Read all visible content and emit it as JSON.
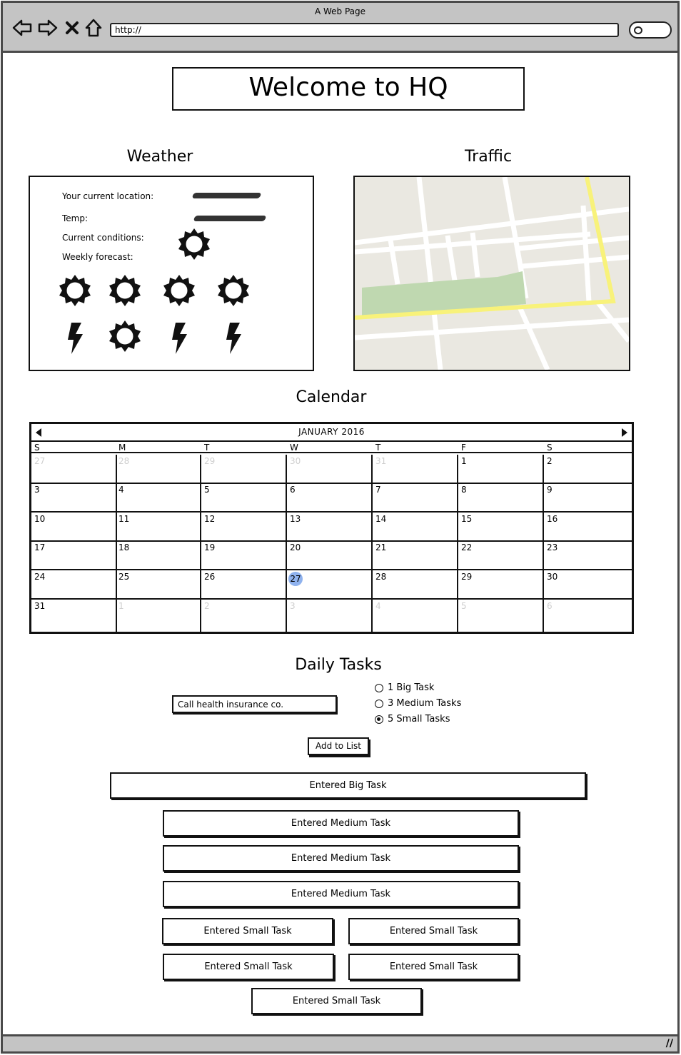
{
  "browser": {
    "window_title": "A Web Page",
    "url": "http://"
  },
  "page": {
    "title": "Welcome to HQ"
  },
  "weather": {
    "heading": "Weather",
    "location_label": "Your current location:",
    "temp_label": "Temp:",
    "conditions_label": "Current conditions:",
    "forecast_label": "Weekly forecast:",
    "current_condition_icon": "sun-icon",
    "forecast_icons": [
      "sun-icon",
      "sun-icon",
      "sun-icon",
      "sun-icon",
      "lightning-icon",
      "sun-icon",
      "lightning-icon",
      "lightning-icon"
    ]
  },
  "traffic": {
    "heading": "Traffic"
  },
  "calendar": {
    "heading": "Calendar",
    "month_label": "JANUARY 2016",
    "weekdays": [
      "S",
      "M",
      "T",
      "W",
      "T",
      "F",
      "S"
    ],
    "weeks": [
      [
        "27",
        "28",
        "29",
        "30",
        "31",
        "1",
        "2"
      ],
      [
        "3",
        "4",
        "5",
        "6",
        "7",
        "8",
        "9"
      ],
      [
        "10",
        "11",
        "12",
        "13",
        "14",
        "15",
        "16"
      ],
      [
        "17",
        "18",
        "19",
        "20",
        "21",
        "22",
        "23"
      ],
      [
        "24",
        "25",
        "26",
        "27",
        "28",
        "29",
        "30"
      ],
      [
        "31",
        "1",
        "2",
        "3",
        "4",
        "5",
        "6"
      ]
    ],
    "today": "27",
    "colors": {
      "today": "#8fb2ee",
      "muted": "#cfcfcf"
    }
  },
  "tasks": {
    "heading": "Daily Tasks",
    "input_value": "Call health insurance co.",
    "options": [
      {
        "label": "1 Big Task",
        "checked": false
      },
      {
        "label": "3 Medium Tasks",
        "checked": false
      },
      {
        "label": "5 Small Tasks",
        "checked": true
      }
    ],
    "add_button": "Add to List",
    "big": "Entered Big Task",
    "medium": [
      "Entered Medium Task",
      "Entered Medium Task",
      "Entered Medium Task"
    ],
    "small": [
      "Entered Small Task",
      "Entered Small Task",
      "Entered Small Task",
      "Entered Small Task",
      "Entered Small Task"
    ]
  },
  "colors": {
    "chrome": "#c4c4c4",
    "map_background": "#eae8e1",
    "map_park": "#bfd8b0",
    "map_highlight_road": "#f8f27a"
  }
}
